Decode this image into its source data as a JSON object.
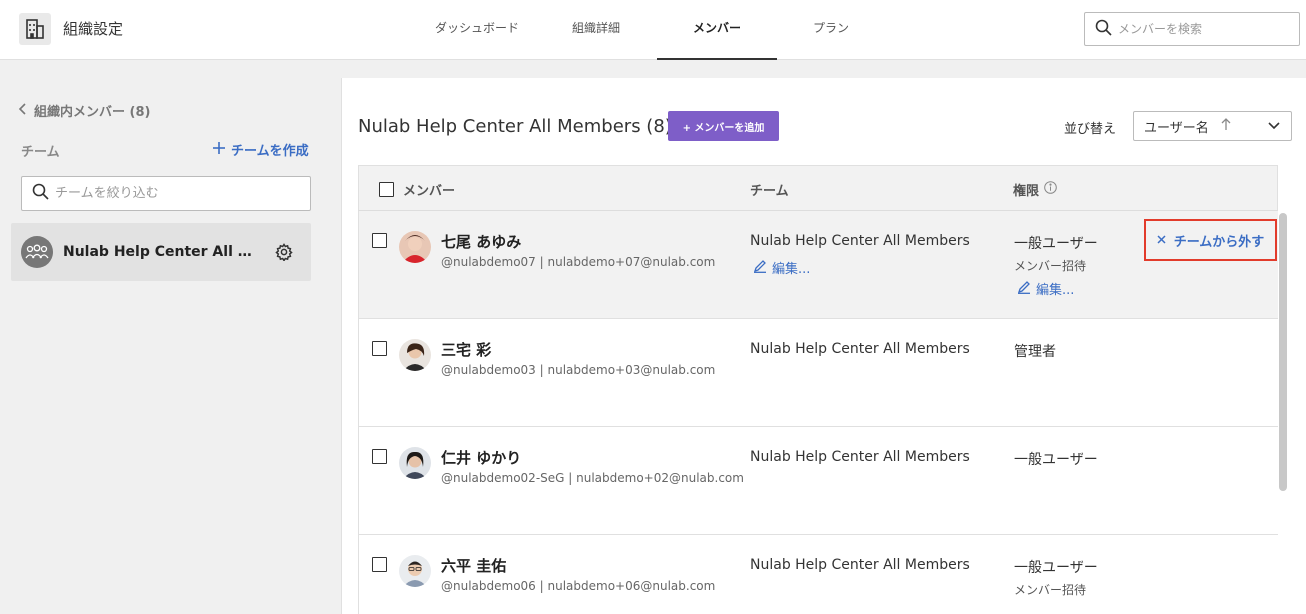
{
  "header": {
    "org_title": "組織設定",
    "tabs": [
      {
        "label": "ダッシュボード"
      },
      {
        "label": "組織詳細"
      },
      {
        "label": "メンバー"
      },
      {
        "label": "プラン"
      }
    ],
    "search_placeholder": "メンバーを検索"
  },
  "sidebar": {
    "back_label": "組織内メンバー (8)",
    "team_heading": "チーム",
    "create_team_label": "チームを作成",
    "filter_placeholder": "チームを絞り込む",
    "team_name": "Nulab Help Center All Members"
  },
  "main": {
    "title": "Nulab Help Center All Members (8)",
    "add_member_label": "+ メンバーを追加",
    "sort_label": "並び替え",
    "sort_value": "ユーザー名",
    "columns": {
      "member": "メンバー",
      "team": "チーム",
      "role": "権限"
    },
    "edit_label": "編集...",
    "remove_label": "チームから外す",
    "rows": [
      {
        "name": "七尾 あゆみ",
        "sub": "@nulabdemo07 | nulabdemo+07@nulab.com",
        "team": "Nulab Help Center All Members",
        "role": "一般ユーザー",
        "role_sub": "メンバー招待"
      },
      {
        "name": "三宅 彩",
        "sub": "@nulabdemo03 | nulabdemo+03@nulab.com",
        "team": "Nulab Help Center All Members",
        "role": "管理者",
        "role_sub": ""
      },
      {
        "name": "仁井 ゆかり",
        "sub": "@nulabdemo02-SeG | nulabdemo+02@nulab.com",
        "team": "Nulab Help Center All Members",
        "role": "一般ユーザー",
        "role_sub": ""
      },
      {
        "name": "六平 圭佑",
        "sub": "@nulabdemo06 | nulabdemo+06@nulab.com",
        "team": "Nulab Help Center All Members",
        "role": "一般ユーザー",
        "role_sub": "メンバー招待"
      }
    ]
  },
  "colors": {
    "accent_purple": "#7e5ec8",
    "link_blue": "#3b6dc4",
    "highlight_red": "#e23b2b"
  }
}
